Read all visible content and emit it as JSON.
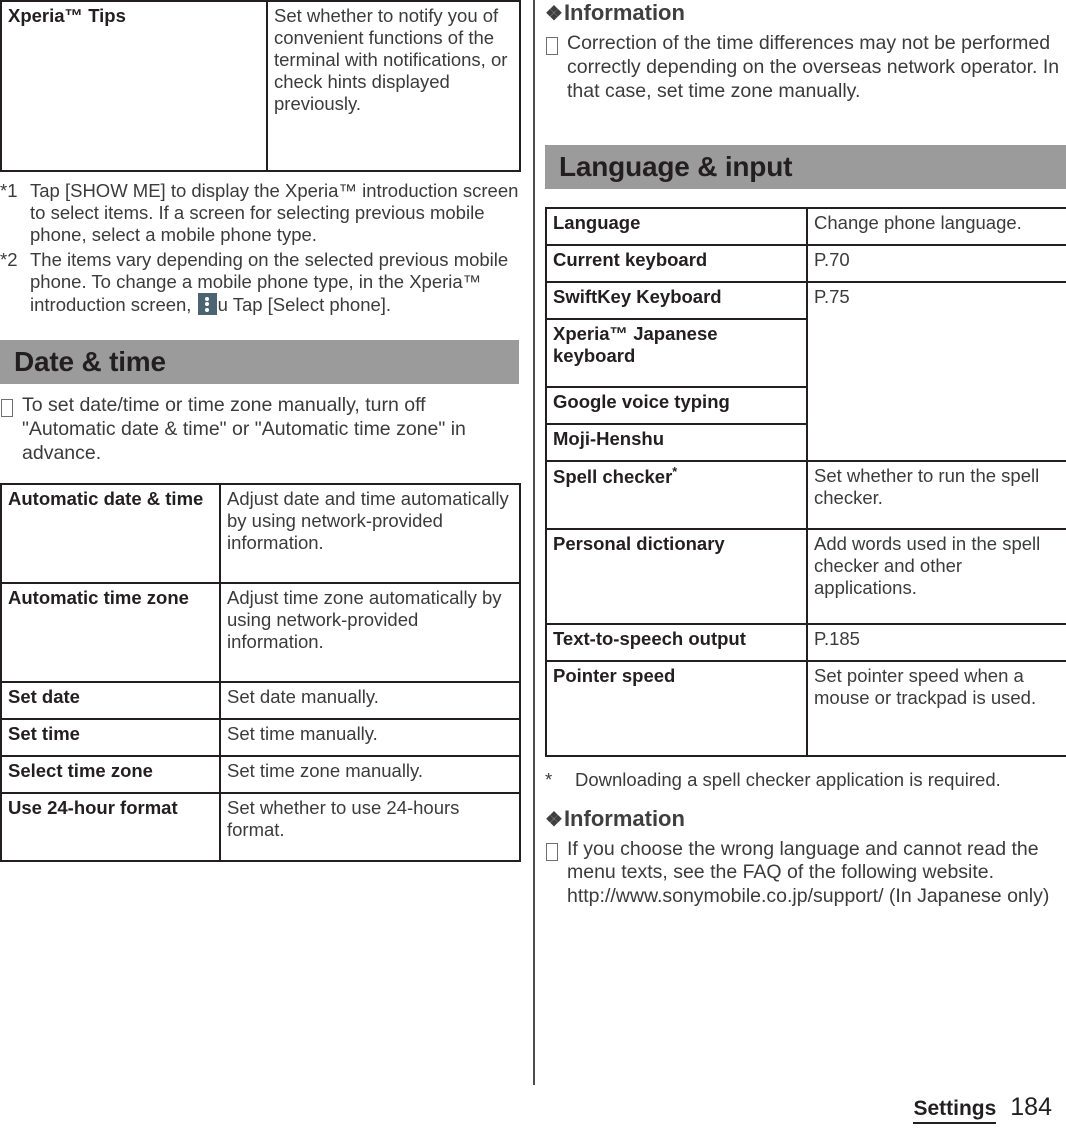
{
  "document": {
    "footer": {
      "chapter": "Settings",
      "page_number": "184"
    }
  },
  "left_column": {
    "top_table": {
      "rows": [
        {
          "label": "Xperia™ Tips",
          "value": "Set whether to notify you of convenient functions of the terminal with notifications, or check hints displayed previously."
        }
      ]
    },
    "footnotes": [
      {
        "mark": "*1",
        "text": "Tap [SHOW ME] to display the Xperia™ introduction screen to select items. If a screen for selecting previous mobile phone, select a mobile phone type."
      },
      {
        "mark": "*2",
        "text_before_icon": "The items vary depending on the selected previous mobile phone. To change a mobile phone type, in the Xperia™ introduction screen, ",
        "icon": "three-dot-menu-icon",
        "text_after_icon": "u Tap [Select phone]."
      }
    ],
    "section": {
      "title": "Date & time",
      "note": "To set date/time or time zone manually, turn off \"Automatic date & time\" or \"Automatic time zone\" in advance.",
      "table": {
        "rows": [
          {
            "label": "Automatic date & time",
            "value": "Adjust date and time automatically by using network-provided information."
          },
          {
            "label": "Automatic time zone",
            "value": "Adjust time zone automatically by using network-provided information."
          },
          {
            "label": "Set date",
            "value": "Set date manually."
          },
          {
            "label": "Set time",
            "value": "Set time manually."
          },
          {
            "label": "Select time zone",
            "value": "Set time zone manually."
          },
          {
            "label": "Use 24-hour format",
            "value": "Set whether to use 24-hours format."
          }
        ]
      }
    }
  },
  "right_column": {
    "information_top": {
      "heading": "Information",
      "flower": "❖",
      "items": [
        "Correction of the time differences may not be performed correctly depending on the overseas network operator. In that case, set time zone manually."
      ]
    },
    "section": {
      "title": "Language & input",
      "table": {
        "rows": [
          {
            "label": "Language",
            "value": "Change phone language.",
            "merged": false
          },
          {
            "label": "Current keyboard",
            "value": "P.70",
            "merged": false
          },
          {
            "label": "SwiftKey Keyboard",
            "value": "P.75",
            "merged": true,
            "rowspan": 4
          },
          {
            "label": "Xperia™ Japanese keyboard",
            "value": "",
            "merged": true
          },
          {
            "label": "Google voice typing",
            "value": "",
            "merged": true
          },
          {
            "label": "Moji-Henshu",
            "value": "",
            "merged": true
          },
          {
            "label": "Spell checker",
            "label_sup": "*",
            "value": "Set whether to run the spell checker.",
            "merged": false
          },
          {
            "label": "Personal dictionary",
            "value": "Add words used in the spell checker and other applications.",
            "merged": false
          },
          {
            "label": "Text-to-speech output",
            "value": "P.185",
            "merged": false
          },
          {
            "label": "Pointer speed",
            "value": "Set pointer speed when a mouse or trackpad is used.",
            "merged": false
          }
        ]
      }
    },
    "footnote": {
      "mark": "*",
      "text": "Downloading a spell checker application is required."
    },
    "information_bottom": {
      "heading": "Information",
      "flower": "❖",
      "items": [
        "If you choose the wrong language and cannot read the menu texts, see the FAQ of the following website. http://www.sonymobile.co.jp/support/ (In Japanese only)"
      ]
    }
  },
  "colors": {
    "section_bar": "#9b9b9b",
    "table_border": "#231f20",
    "icon_bg": "#4b6472",
    "text": "#231f20",
    "value_text": "#3b3b3b"
  }
}
